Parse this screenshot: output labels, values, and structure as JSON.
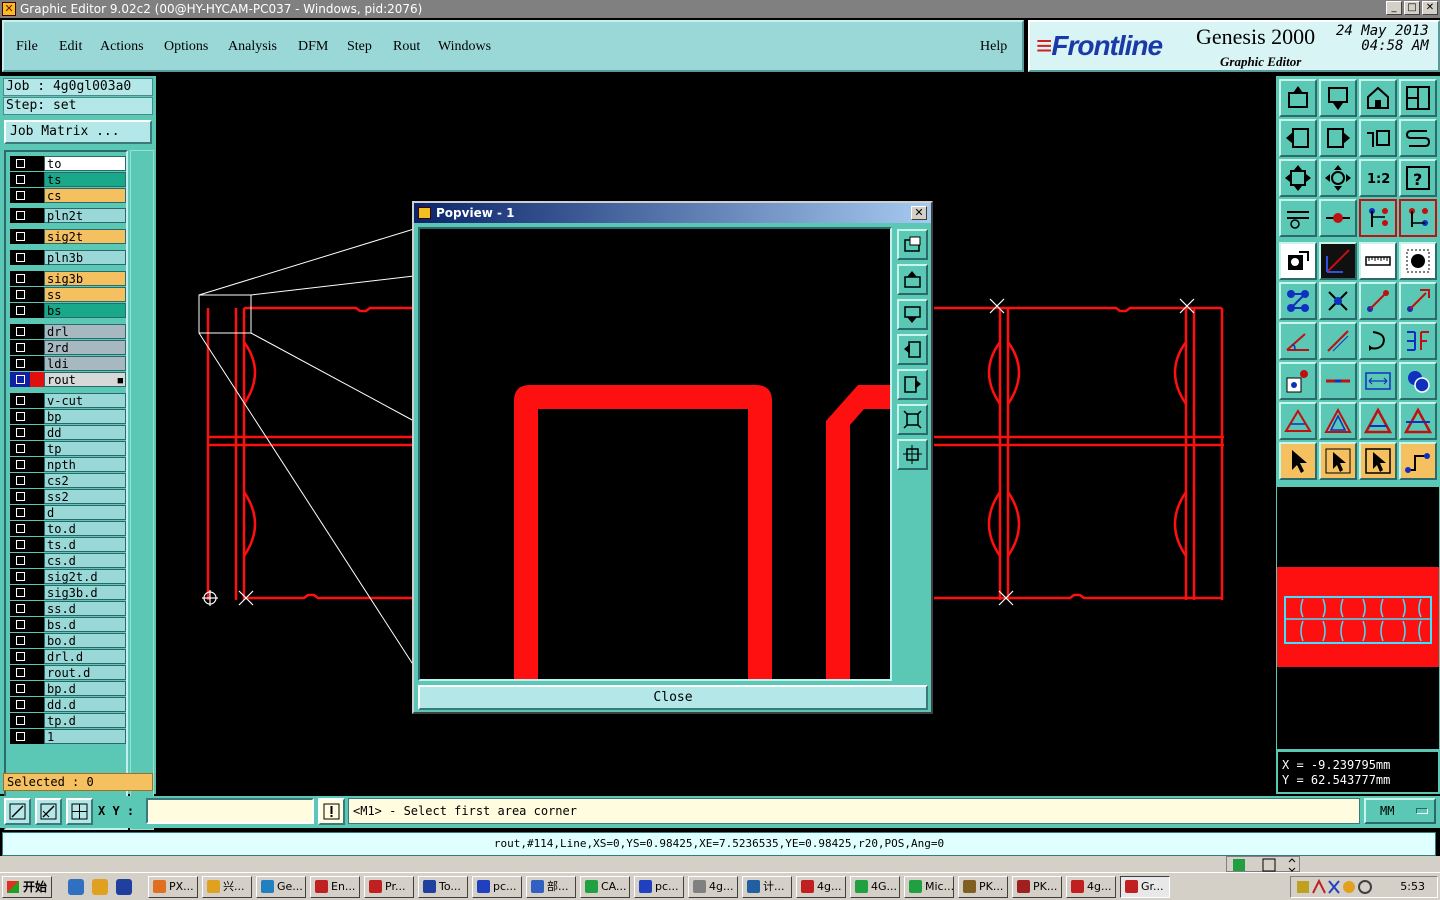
{
  "window": {
    "title": "Graphic Editor 9.02c2 (00@HY-HYCAM-PC037 - Windows, pid:2076)"
  },
  "menu": {
    "items": [
      "File",
      "Edit",
      "Actions",
      "Options",
      "Analysis",
      "DFM",
      "Step",
      "Rout",
      "Windows"
    ],
    "help": "Help"
  },
  "brand": {
    "logo": "Frontline",
    "product": "Genesis 2000",
    "subtitle": "Graphic Editor",
    "date": "24 May 2013",
    "time": "04:58 AM"
  },
  "job": {
    "job_line": "Job : 4g0gl003a0",
    "step_line": "Step: set",
    "matrix_button": "Job Matrix ..."
  },
  "layers": [
    {
      "name": "to",
      "color": "#ffffff"
    },
    {
      "name": "ts",
      "color": "#1aa88a"
    },
    {
      "name": "cs",
      "color": "#f5c060"
    },
    {
      "name": "pln2t",
      "color": "#9ad8d8"
    },
    {
      "name": "sig2t",
      "color": "#f5c060"
    },
    {
      "name": "pln3b",
      "color": "#9ad8d8"
    },
    {
      "name": "sig3b",
      "color": "#f5c060"
    },
    {
      "name": "ss",
      "color": "#f5c060"
    },
    {
      "name": "bs",
      "color": "#1aa88a"
    },
    {
      "name": "drl",
      "color": "#a8b8c0"
    },
    {
      "name": "2rd",
      "color": "#a8b8c0"
    },
    {
      "name": "ldi",
      "color": "#a8b8c0"
    },
    {
      "name": "rout",
      "color": "#d8d8d8",
      "active": true
    },
    {
      "name": "v-cut",
      "color": "#9ad8d8"
    },
    {
      "name": "bp",
      "color": "#9ad8d8"
    },
    {
      "name": "dd",
      "color": "#9ad8d8"
    },
    {
      "name": "tp",
      "color": "#9ad8d8"
    },
    {
      "name": "npth",
      "color": "#9ad8d8"
    },
    {
      "name": "cs2",
      "color": "#9ad8d8"
    },
    {
      "name": "ss2",
      "color": "#9ad8d8"
    },
    {
      "name": "d",
      "color": "#9ad8d8"
    },
    {
      "name": "to.d",
      "color": "#9ad8d8"
    },
    {
      "name": "ts.d",
      "color": "#9ad8d8"
    },
    {
      "name": "cs.d",
      "color": "#9ad8d8"
    },
    {
      "name": "sig2t.d",
      "color": "#9ad8d8"
    },
    {
      "name": "sig3b.d",
      "color": "#9ad8d8"
    },
    {
      "name": "ss.d",
      "color": "#9ad8d8"
    },
    {
      "name": "bs.d",
      "color": "#9ad8d8"
    },
    {
      "name": "bo.d",
      "color": "#9ad8d8"
    },
    {
      "name": "drl.d",
      "color": "#9ad8d8"
    },
    {
      "name": "rout.d",
      "color": "#9ad8d8"
    },
    {
      "name": "bp.d",
      "color": "#9ad8d8"
    },
    {
      "name": "dd.d",
      "color": "#9ad8d8"
    },
    {
      "name": "tp.d",
      "color": "#9ad8d8"
    },
    {
      "name": "1",
      "color": "#9ad8d8"
    }
  ],
  "selected_label": "Selected : 0",
  "popview": {
    "title": "Popview - 1",
    "close_label": "Close"
  },
  "coords": {
    "x_line": "X = -9.239795mm",
    "y_line": "Y = 62.543777mm"
  },
  "cmd": {
    "xy_label": "X Y :",
    "xy_value": "",
    "prompt": "<M1> - Select first area corner",
    "units": "MM"
  },
  "status_line": "rout,#114,Line,XS=0,YS=0.98425,XE=7.5236535,YE=0.98425,r20,POS,Ang=0",
  "taskbar": {
    "start": "开始",
    "tasks": [
      {
        "label": "PX...",
        "color": "#e07020"
      },
      {
        "label": "兴...",
        "color": "#e0a020"
      },
      {
        "label": "Ge...",
        "color": "#2080c0"
      },
      {
        "label": "En...",
        "color": "#c02020"
      },
      {
        "label": "Pr...",
        "color": "#c02020"
      },
      {
        "label": "To...",
        "color": "#2040a0"
      },
      {
        "label": "pc...",
        "color": "#2040c0"
      },
      {
        "label": "部...",
        "color": "#3060c0"
      },
      {
        "label": "CA...",
        "color": "#20a040"
      },
      {
        "label": "pc...",
        "color": "#2040c0"
      },
      {
        "label": "4g...",
        "color": "#808080"
      },
      {
        "label": "计...",
        "color": "#2060a0"
      },
      {
        "label": "4g...",
        "color": "#c02020"
      },
      {
        "label": "4G...",
        "color": "#20a040"
      },
      {
        "label": "Mic...",
        "color": "#20a040"
      },
      {
        "label": "PK...",
        "color": "#806020"
      },
      {
        "label": "PK...",
        "color": "#a02020"
      },
      {
        "label": "4g...",
        "color": "#c02020"
      },
      {
        "label": "Gr...",
        "color": "#c02020",
        "active": true
      }
    ],
    "clock": "5:53"
  },
  "colors": {
    "panel": "#5ac8b4",
    "menu": "#9ad8d8",
    "rout_line": "#ff1010",
    "highlight": "#f5c060"
  }
}
